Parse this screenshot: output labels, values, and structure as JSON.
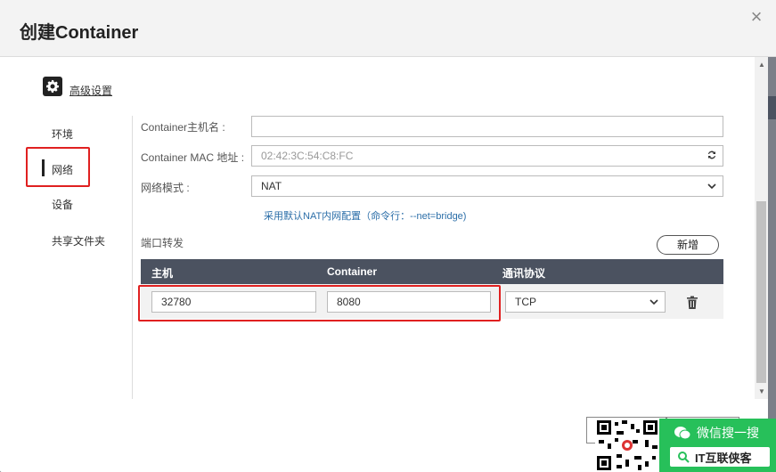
{
  "dialog": {
    "title": "创建Container",
    "close_symbol": "×"
  },
  "advanced": {
    "label": "高级设置",
    "icon": "gear-icon"
  },
  "sidebar": {
    "items": [
      {
        "label": "环境"
      },
      {
        "label": "网络"
      },
      {
        "label": "设备"
      },
      {
        "label": "共享文件夹"
      }
    ],
    "active": "网络"
  },
  "network": {
    "hostname_label": "Container主机名 :",
    "hostname_value": "",
    "mac_label": "Container MAC 地址 :",
    "mac_value": "02:42:3C:54:C8:FC",
    "mode_label": "网络模式 :",
    "mode_value": "NAT",
    "mode_hint": "采用默认NAT内网配置（命令行：--net=bridge)"
  },
  "port_forward": {
    "section_label": "端口转发",
    "add_button": "新增",
    "columns": [
      "主机",
      "Container",
      "通讯协议"
    ],
    "rows": [
      {
        "host": "32780",
        "container": "8080",
        "protocol": "TCP"
      }
    ]
  },
  "watermark": {
    "search_text": "微信搜一搜",
    "account": "IT互联侠客"
  },
  "colors": {
    "header_bg": "#4b5260",
    "highlight": "#e02020",
    "hint": "#2b6ea8",
    "wechat_green": "#27c05a"
  }
}
